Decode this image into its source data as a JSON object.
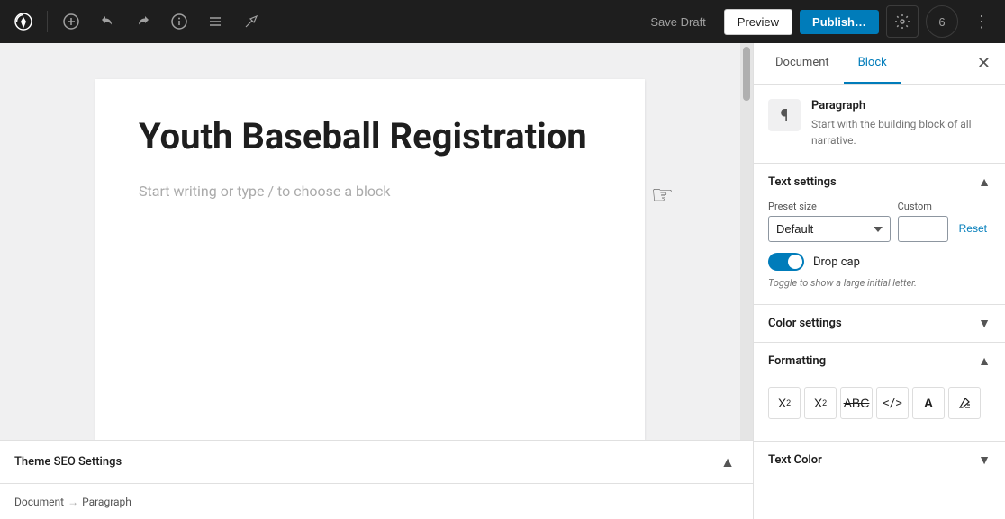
{
  "toolbar": {
    "logo": "W",
    "save_draft_label": "Save Draft",
    "preview_label": "Preview",
    "publish_label": "Publish…",
    "user_count": "6"
  },
  "editor": {
    "title": "Youth Baseball Registration",
    "placeholder": "Start writing or type / to choose a block"
  },
  "breadcrumb": {
    "document": "Document",
    "separator": "→",
    "block": "Paragraph"
  },
  "seo": {
    "label": "Theme SEO Settings",
    "toggle_icon": "▲"
  },
  "sidebar": {
    "tab_document": "Document",
    "tab_block": "Block",
    "block_icon": "¶",
    "block_title": "Paragraph",
    "block_description": "Start with the building block of all narrative.",
    "text_settings_title": "Text settings",
    "preset_size_label": "Preset size",
    "custom_label": "Custom",
    "preset_default": "Default",
    "reset_label": "Reset",
    "drop_cap_label": "Drop cap",
    "drop_cap_hint": "Toggle to show a large initial letter.",
    "color_settings_title": "Color settings",
    "formatting_title": "Formatting",
    "text_color_title": "Text Color",
    "formatting_icons": [
      {
        "name": "superscript",
        "symbol": "X²",
        "title": "Superscript"
      },
      {
        "name": "subscript",
        "symbol": "X₂",
        "title": "Subscript"
      },
      {
        "name": "strikethrough",
        "symbol": "ABC̶",
        "title": "Strikethrough"
      },
      {
        "name": "inline-code",
        "symbol": "</>",
        "title": "Inline code"
      },
      {
        "name": "keyboard",
        "symbol": "A",
        "title": "Keyboard"
      },
      {
        "name": "clear-formatting",
        "symbol": "✕",
        "title": "Clear formatting"
      }
    ]
  }
}
